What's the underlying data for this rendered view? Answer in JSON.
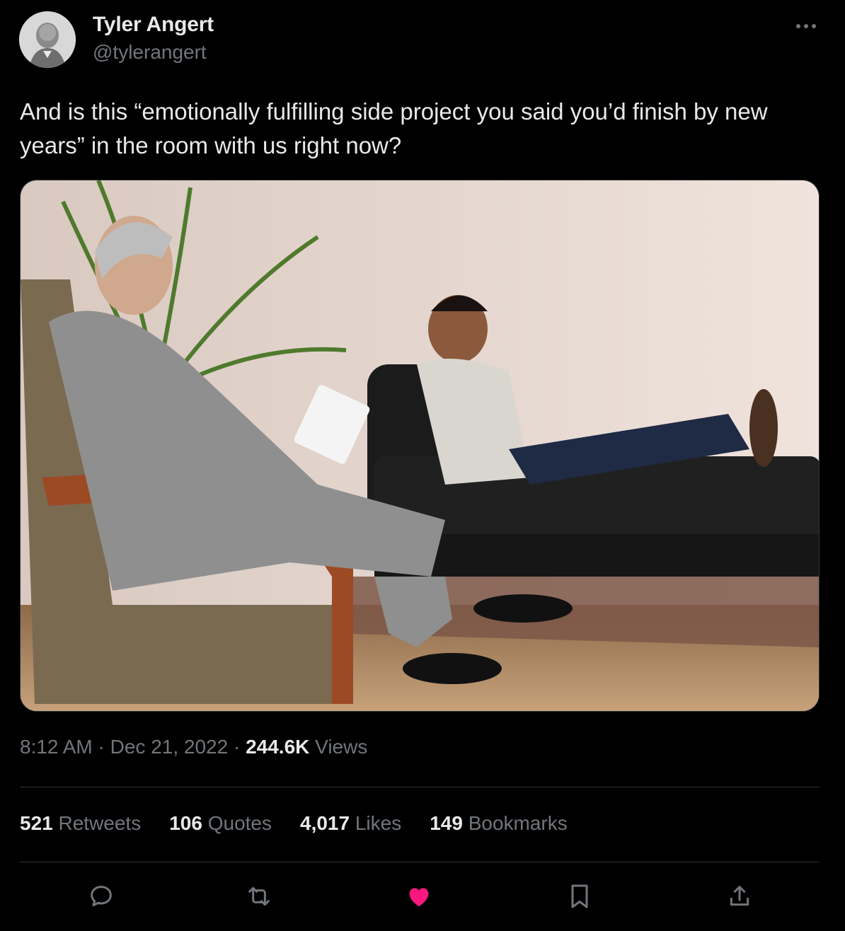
{
  "author": {
    "name": "Tyler Angert",
    "handle": "@tylerangert",
    "avatar_icon": "sketched-portrait-avatar"
  },
  "more_icon": "more-horizontal-icon",
  "tweet": {
    "text": "And is this “emotionally fulfilling side project you said you’d finish by new years” in the room with us right now?"
  },
  "media": {
    "kind": "photo",
    "subject": "therapist-session-photo"
  },
  "meta": {
    "time": "8:12 AM",
    "sep1": " · ",
    "date": "Dec 21, 2022",
    "sep2": " · ",
    "views_count": "244.6K",
    "views_label": " Views"
  },
  "stats": {
    "retweets_count": "521",
    "retweets_label": " Retweets",
    "quotes_count": "106",
    "quotes_label": " Quotes",
    "likes_count": "4,017",
    "likes_label": " Likes",
    "bookmarks_count": "149",
    "bookmarks_label": " Bookmarks"
  },
  "actions": {
    "reply_icon": "reply-icon",
    "retweet_icon": "retweet-icon",
    "like_icon": "heart-filled-icon",
    "bookmark_icon": "bookmark-icon",
    "share_icon": "share-icon"
  },
  "colors": {
    "background": "#000000",
    "text_primary": "#e7e9ea",
    "text_secondary": "#71767b",
    "divider": "#2f3336",
    "like": "#f91880"
  }
}
